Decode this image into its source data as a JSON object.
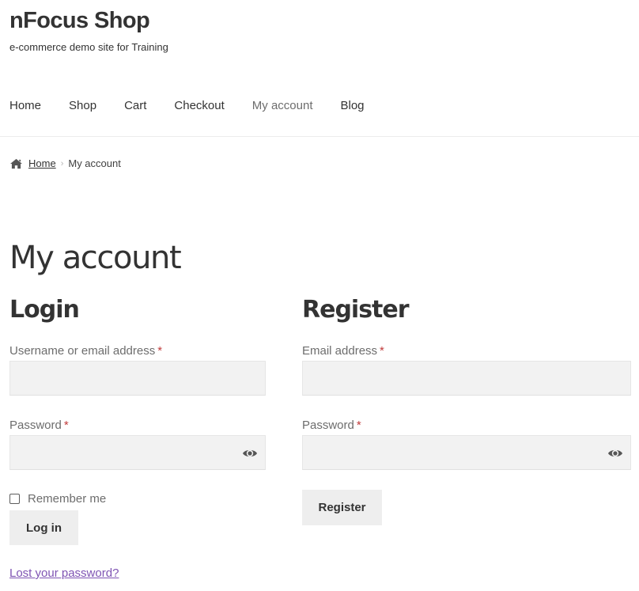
{
  "site": {
    "title": "nFocus Shop",
    "description": "e-commerce demo site for Training"
  },
  "nav": {
    "items": [
      "Home",
      "Shop",
      "Cart",
      "Checkout",
      "My account",
      "Blog"
    ],
    "current": "My account"
  },
  "breadcrumb": {
    "home_icon": "home-icon",
    "home": "Home",
    "separator": "›",
    "current": "My account"
  },
  "page": {
    "title": "My account"
  },
  "login": {
    "title": "Login",
    "username_label": "Username or email address",
    "password_label": "Password",
    "required_marker": "*",
    "remember_label": "Remember me",
    "remember_checked": false,
    "submit_label": "Log in",
    "lost_password": "Lost your password?"
  },
  "register": {
    "title": "Register",
    "email_label": "Email address",
    "password_label": "Password",
    "required_marker": "*",
    "submit_label": "Register"
  },
  "colors": {
    "link_purple": "#7f54b3",
    "required_red": "#c13b3b",
    "field_bg": "#f2f2f2",
    "button_bg": "#eeeeee"
  }
}
